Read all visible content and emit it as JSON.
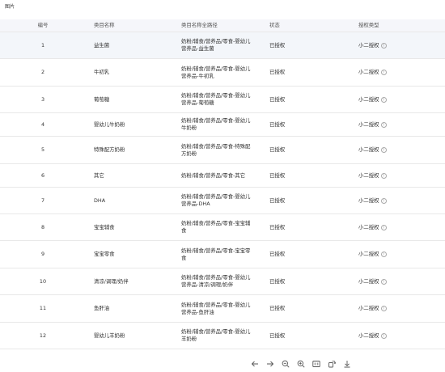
{
  "page_label": "图片",
  "table": {
    "headers": {
      "idx": "编号",
      "name": "类目名称",
      "path": "类目名称全路径",
      "status": "状态",
      "type": "授权类型"
    },
    "rows": [
      {
        "idx": "1",
        "name": "益生菌",
        "path": "奶粉/辅食/营养品/零食-婴幼儿营养品-益生菌",
        "status": "已授权",
        "type": "小二授权"
      },
      {
        "idx": "2",
        "name": "牛初乳",
        "path": "奶粉/辅食/营养品/零食-婴幼儿营养品-牛初乳",
        "status": "已授权",
        "type": "小二授权"
      },
      {
        "idx": "3",
        "name": "葡萄糖",
        "path": "奶粉/辅食/营养品/零食-婴幼儿营养品-葡萄糖",
        "status": "已授权",
        "type": "小二授权"
      },
      {
        "idx": "4",
        "name": "婴幼儿牛奶粉",
        "path": "奶粉/辅食/营养品/零食-婴幼儿牛奶粉",
        "status": "已授权",
        "type": "小二授权"
      },
      {
        "idx": "5",
        "name": "特殊配方奶粉",
        "path": "奶粉/辅食/营养品/零食-特殊配方奶粉",
        "status": "已授权",
        "type": "小二授权"
      },
      {
        "idx": "6",
        "name": "其它",
        "path": "奶粉/辅食/营养品/零食-其它",
        "status": "已授权",
        "type": "小二授权"
      },
      {
        "idx": "7",
        "name": "DHA",
        "path": "奶粉/辅食/营养品/零食-婴幼儿营养品-DHA",
        "status": "已授权",
        "type": "小二授权"
      },
      {
        "idx": "8",
        "name": "宝宝辅食",
        "path": "奶粉/辅食/营养品/零食-宝宝辅食",
        "status": "已授权",
        "type": "小二授权"
      },
      {
        "idx": "9",
        "name": "宝宝零食",
        "path": "奶粉/辅食/营养品/零食-宝宝零食",
        "status": "已授权",
        "type": "小二授权"
      },
      {
        "idx": "10",
        "name": "清凉/调理/奶伴",
        "path": "奶粉/辅食/营养品/零食-婴幼儿营养品-清凉/调理/奶伴",
        "status": "已授权",
        "type": "小二授权"
      },
      {
        "idx": "11",
        "name": "鱼肝油",
        "path": "奶粉/辅食/营养品/零食-婴幼儿营养品-鱼肝油",
        "status": "已授权",
        "type": "小二授权"
      },
      {
        "idx": "12",
        "name": "婴幼儿羊奶粉",
        "path": "奶粉/辅食/营养品/零食-婴幼儿羊奶粉",
        "status": "已授权",
        "type": "小二授权"
      }
    ]
  },
  "toolbar": {
    "items": [
      "arrow-left-icon",
      "arrow-right-icon",
      "zoom-out-icon",
      "zoom-in-icon",
      "one-to-one-icon",
      "rotate-icon",
      "download-icon"
    ]
  },
  "colors": {
    "header_bg": "#f5f6fa",
    "highlight_row_bg": "#f3f6fa",
    "border": "#e8e8e8"
  }
}
